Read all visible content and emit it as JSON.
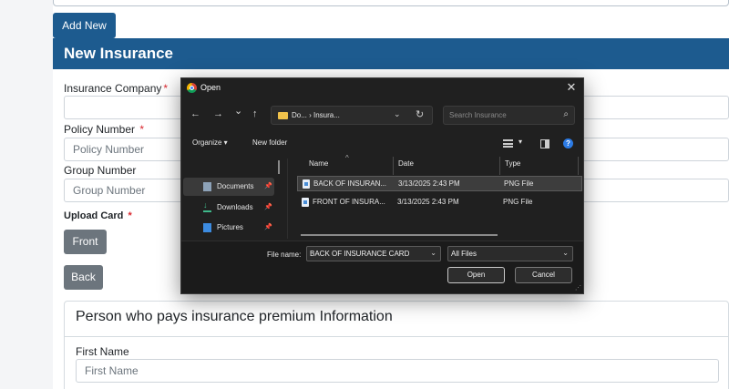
{
  "page": {
    "add_new_label": "Add New",
    "section_title": "New Insurance",
    "insurance_company_label": "Insurance Company",
    "policy_number_label": "Policy Number",
    "policy_number_placeholder": "Policy Number",
    "group_number_label": "Group Number",
    "group_number_placeholder": "Group Number",
    "upload_card_label": "Upload Card",
    "required_mark": "*",
    "front_button": "Front",
    "back_button": "Back",
    "payer_section_title": "Person who pays insurance premium Information",
    "first_name_label": "First Name",
    "first_name_placeholder": "First Name"
  },
  "dialog": {
    "title": "Open",
    "close_glyph": "✕",
    "nav": {
      "back": "←",
      "forward": "→",
      "recent": "⌄",
      "up": "↑"
    },
    "address_path": "Do...  ›  Insura...",
    "address_prefix": "›",
    "search_placeholder": "Search Insurance",
    "toolbar": {
      "organize": "Organize ▾",
      "new_folder": "New folder",
      "view_caret": "▾",
      "help": "?"
    },
    "nav_pane": [
      {
        "label": "Documents",
        "icon": "documents-icon"
      },
      {
        "label": "Downloads",
        "icon": "downloads-icon"
      },
      {
        "label": "Pictures",
        "icon": "pictures-icon"
      }
    ],
    "columns": {
      "name": "Name",
      "date": "Date",
      "type": "Type"
    },
    "files": [
      {
        "name": "BACK OF INSURAN...",
        "date": "3/13/2025 2:43 PM",
        "type": "PNG File",
        "selected": true
      },
      {
        "name": "FRONT OF INSURA...",
        "date": "3/13/2025 2:43 PM",
        "type": "PNG File",
        "selected": false
      }
    ],
    "file_name_label": "File name:",
    "file_name_value": "BACK OF INSURANCE CARD",
    "file_type_value": "All Files",
    "open_button": "Open",
    "cancel_button": "Cancel"
  },
  "colors": {
    "brand": "#1d5b8f",
    "required": "#d9272e",
    "button_gray": "#6c757d"
  }
}
